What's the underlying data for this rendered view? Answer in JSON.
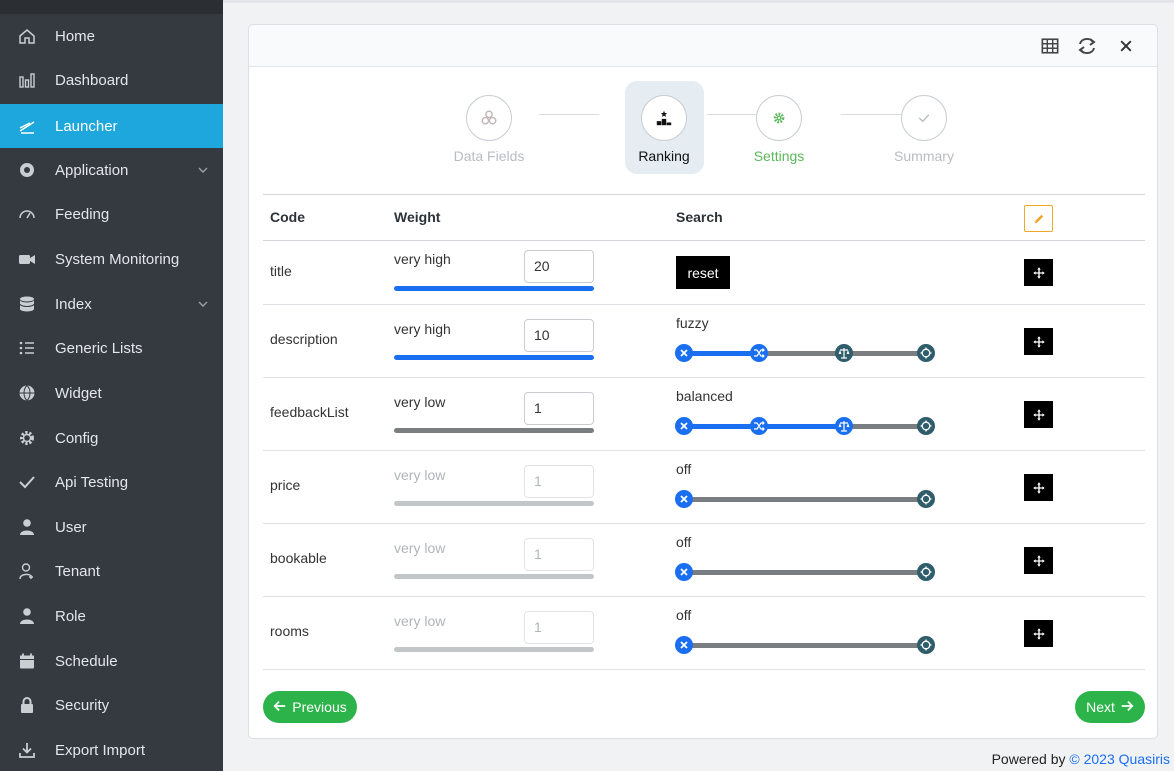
{
  "sidebar": {
    "items": [
      {
        "label": "Home",
        "icon": "home-icon"
      },
      {
        "label": "Dashboard",
        "icon": "bar-chart-icon"
      },
      {
        "label": "Launcher",
        "icon": "launcher-icon",
        "active": true
      },
      {
        "label": "Application",
        "icon": "app-circle-icon",
        "has_children": true
      },
      {
        "label": "Feeding",
        "icon": "gauge-icon"
      },
      {
        "label": "System Monitoring",
        "icon": "video-camera-icon"
      },
      {
        "label": "Index",
        "icon": "database-icon",
        "has_children": true
      },
      {
        "label": "Generic Lists",
        "icon": "list-icon"
      },
      {
        "label": "Widget",
        "icon": "globe-icon"
      },
      {
        "label": "Config",
        "icon": "gear-icon"
      },
      {
        "label": "Api Testing",
        "icon": "check-icon"
      },
      {
        "label": "User",
        "icon": "user-icon"
      },
      {
        "label": "Tenant",
        "icon": "user-plus-icon"
      },
      {
        "label": "Role",
        "icon": "user-role-icon"
      },
      {
        "label": "Schedule",
        "icon": "calendar-icon"
      },
      {
        "label": "Security",
        "icon": "lock-icon"
      },
      {
        "label": "Export Import",
        "icon": "download-icon"
      }
    ]
  },
  "header": {
    "buttons": [
      "grid-icon",
      "sync-icon",
      "close-icon"
    ]
  },
  "stepper": {
    "steps": [
      {
        "label": "Data Fields",
        "state": "done",
        "icon": "cubes-icon"
      },
      {
        "label": "Ranking",
        "state": "active",
        "icon": "podium-icon"
      },
      {
        "label": "Settings",
        "state": "next",
        "icon": "gear-icon"
      },
      {
        "label": "Summary",
        "state": "pending",
        "icon": "check-icon"
      }
    ]
  },
  "table": {
    "headers": {
      "code": "Code",
      "weight": "Weight",
      "search": "Search"
    },
    "rows": [
      {
        "code": "title",
        "weight_label": "very high",
        "weight_value": "20",
        "weight_level": 1.0,
        "search_label": "reset",
        "search_type": "reset",
        "enabled": true
      },
      {
        "code": "description",
        "weight_label": "very high",
        "weight_value": "10",
        "weight_level": 1.0,
        "search_label": "fuzzy",
        "search_type": "slider",
        "search_level": 1,
        "enabled": true
      },
      {
        "code": "feedbackList",
        "weight_label": "very low",
        "weight_value": "1",
        "weight_level": 0.0,
        "search_label": "balanced",
        "search_type": "slider",
        "search_level": 2,
        "enabled": true
      },
      {
        "code": "price",
        "weight_label": "very low",
        "weight_value": "1",
        "weight_level": 0.0,
        "search_label": "off",
        "search_type": "slider",
        "search_level": 0,
        "enabled": false
      },
      {
        "code": "bookable",
        "weight_label": "very low",
        "weight_value": "1",
        "weight_level": 0.0,
        "search_label": "off",
        "search_type": "slider",
        "search_level": 0,
        "enabled": false
      },
      {
        "code": "rooms",
        "weight_label": "very low",
        "weight_value": "1",
        "weight_level": 0.0,
        "search_label": "off",
        "search_type": "slider",
        "search_level": 0,
        "enabled": false
      }
    ]
  },
  "nav_buttons": {
    "previous": "Previous",
    "next": "Next"
  },
  "footer": {
    "powered_by": "Powered by",
    "link": "© 2023 Quasiris"
  },
  "colors": {
    "sidebar": "#353a40",
    "active": "#1ea7dc",
    "blue": "#1a6ff0",
    "green": "#2cb34a",
    "knob_dark": "#2f5d6b"
  }
}
